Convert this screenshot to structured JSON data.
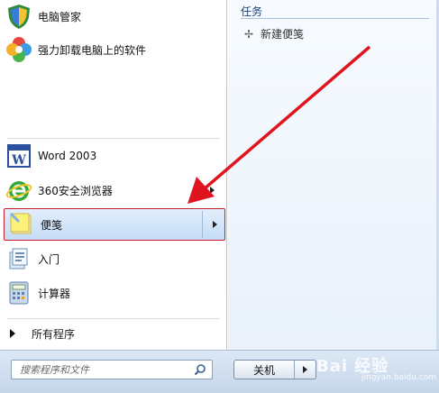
{
  "left_pane": {
    "items": [
      {
        "label": "电脑管家",
        "icon": "shield-icon"
      },
      {
        "label": "强力卸载电脑上的软件",
        "icon": "flower-icon"
      },
      {
        "label": "Word 2003",
        "icon": "word-icon"
      },
      {
        "label": "360安全浏览器",
        "icon": "browser-icon"
      },
      {
        "label": "便笺",
        "icon": "sticky-notes-icon",
        "selected": true
      },
      {
        "label": "入门",
        "icon": "getting-started-icon"
      },
      {
        "label": "计算器",
        "icon": "calculator-icon"
      }
    ],
    "all_programs": "所有程序"
  },
  "right_pane": {
    "section_title": "任务",
    "task_label": "新建便笺",
    "task_icon": "plus-icon"
  },
  "search": {
    "placeholder": "搜索程序和文件",
    "icon": "search-icon"
  },
  "shutdown": {
    "label": "关机"
  },
  "watermark": {
    "brand": "Bai 经验",
    "sub": "jingyan.baidu.com"
  },
  "colors": {
    "highlight_border": "#c81e2a",
    "arrow": "#e0141e",
    "accent": "#1a3d7a"
  }
}
